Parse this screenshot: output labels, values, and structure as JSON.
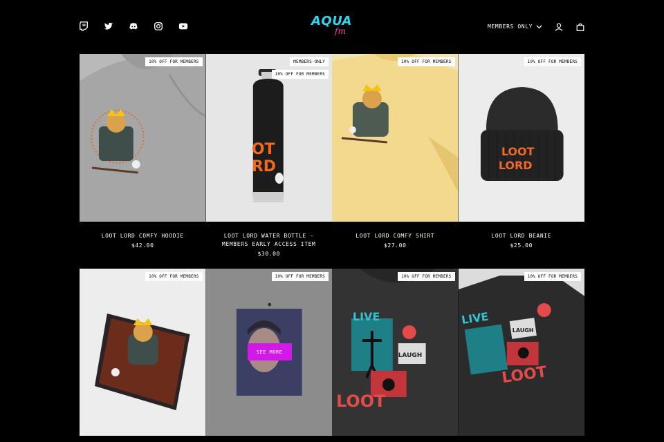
{
  "header": {
    "socials": [
      {
        "icon": "twitch-icon"
      },
      {
        "icon": "twitter-icon"
      },
      {
        "icon": "discord-icon"
      },
      {
        "icon": "instagram-icon"
      },
      {
        "icon": "youtube-icon"
      }
    ],
    "logo": {
      "main": "AQUA",
      "sub": "fm"
    },
    "members_select": "MEMBERS ONLY",
    "account_icon": "user-icon",
    "cart_icon": "bag-icon"
  },
  "colors": {
    "accent_cyan": "#2fd8f0",
    "accent_pink": "#ff3ea8",
    "cta": "#d21ae8"
  },
  "products": [
    {
      "name": "LOOT LORD COMFY HOODIE",
      "price": "$42.00",
      "badges": [
        "10% OFF FOR MEMBERS"
      ]
    },
    {
      "name": "LOOT LORD WATER BOTTLE - MEMBERS EARLY ACCESS ITEM",
      "price": "$30.00",
      "badges": [
        "MEMBERS-ONLY",
        "10% OFF FOR MEMBERS"
      ]
    },
    {
      "name": "LOOT LORD COMFY SHIRT",
      "price": "$27.00",
      "badges": [
        "10% OFF FOR MEMBERS"
      ]
    },
    {
      "name": "LOOT LORD BEANIE",
      "price": "$25.00",
      "badges": [
        "10% OFF FOR MEMBERS"
      ]
    },
    {
      "badges": [
        "10% OFF FOR MEMBERS"
      ]
    },
    {
      "badges": [
        "10% OFF FOR MEMBERS"
      ],
      "cta": "SEE MORE"
    },
    {
      "badges": [
        "10% OFF FOR MEMBERS"
      ]
    },
    {
      "badges": [
        "10% OFF FOR MEMBERS"
      ]
    }
  ]
}
